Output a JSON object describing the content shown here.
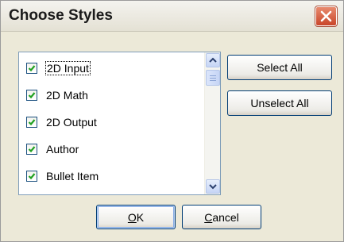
{
  "dialog": {
    "title": "Choose Styles"
  },
  "styles_list": {
    "items": [
      {
        "label": "2D Input",
        "checked": true
      },
      {
        "label": "2D Math",
        "checked": true
      },
      {
        "label": "2D Output",
        "checked": true
      },
      {
        "label": "Author",
        "checked": true
      },
      {
        "label": "Bullet Item",
        "checked": true
      }
    ]
  },
  "buttons": {
    "select_all": "Select All",
    "unselect_all": "Unselect All",
    "ok": "OK",
    "cancel_first": "C",
    "cancel_rest": "ancel"
  },
  "colors": {
    "dialog_background": "#ece9d8",
    "check_color": "#21a121",
    "close_button": "#c9452a"
  },
  "icons": {
    "close": "close-icon",
    "check": "checkmark-icon",
    "scroll_up": "chevron-up-icon",
    "scroll_down": "chevron-down-icon"
  }
}
